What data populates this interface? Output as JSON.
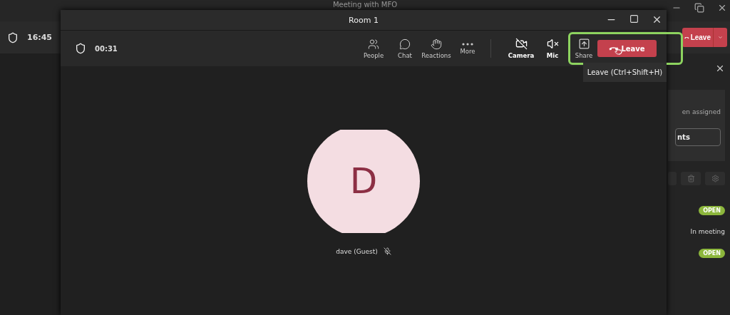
{
  "background_window": {
    "title": "Meeting with MFO",
    "time": "16:45",
    "leave_button": "Leave",
    "panel": {
      "text": "en assigned",
      "button": "nts",
      "rows": [
        {
          "kind": "badge",
          "label": "OPEN",
          "color": "#8cb63c"
        },
        {
          "kind": "text",
          "label": "In meeting"
        },
        {
          "kind": "badge",
          "label": "OPEN",
          "color": "#8cb63c"
        }
      ]
    }
  },
  "window": {
    "title": "Room 1",
    "timer": "00:31",
    "apps": [
      {
        "label": "People"
      },
      {
        "label": "Chat"
      },
      {
        "label": "Reactions"
      },
      {
        "label": "More"
      }
    ],
    "devices": [
      {
        "label": "Camera",
        "on": false
      },
      {
        "label": "Mic",
        "on": false
      },
      {
        "label": "Share",
        "on": true
      }
    ],
    "leave_button": "Leave",
    "tooltip": "Leave (Ctrl+Shift+H)"
  },
  "participant": {
    "initial": "D",
    "name": "dave (Guest)",
    "muted": true
  }
}
